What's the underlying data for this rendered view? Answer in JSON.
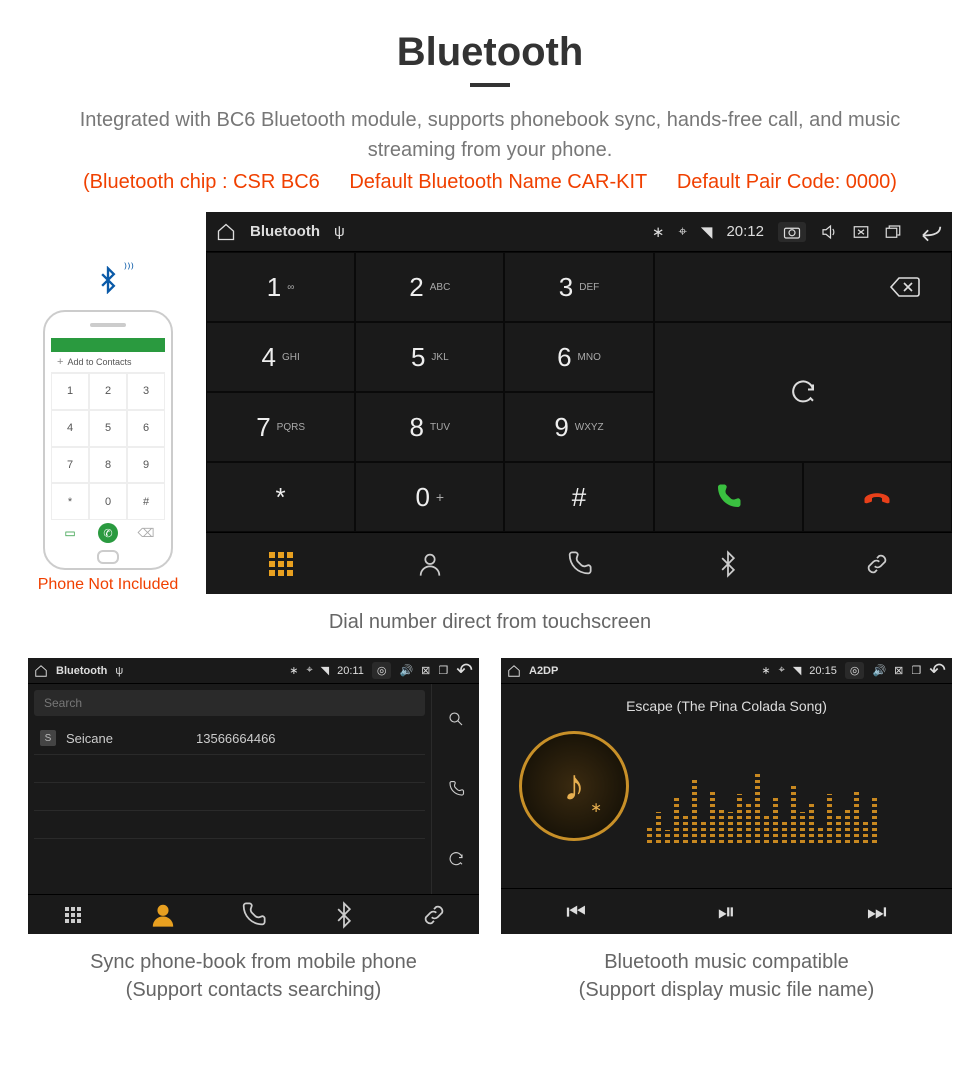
{
  "header": {
    "title": "Bluetooth",
    "description": "Integrated with BC6 Bluetooth module, supports phonebook sync, hands-free call, and music streaming from your phone.",
    "tech": {
      "chip": "(Bluetooth chip : CSR BC6",
      "name": "Default Bluetooth Name CAR-KIT",
      "code": "Default Pair Code: 0000)"
    }
  },
  "phone": {
    "add_contact": "Add to Contacts",
    "note": "Phone Not Included",
    "keys": [
      "1",
      "2",
      "3",
      "4",
      "5",
      "6",
      "7",
      "8",
      "9",
      "*",
      "0",
      "#"
    ]
  },
  "dialer": {
    "status": {
      "title": "Bluetooth",
      "time": "20:12"
    },
    "keys": [
      {
        "n": "1",
        "l": "∞"
      },
      {
        "n": "2",
        "l": "ABC"
      },
      {
        "n": "3",
        "l": "DEF"
      },
      {
        "n": "4",
        "l": "GHI"
      },
      {
        "n": "5",
        "l": "JKL"
      },
      {
        "n": "6",
        "l": "MNO"
      },
      {
        "n": "7",
        "l": "PQRS"
      },
      {
        "n": "8",
        "l": "TUV"
      },
      {
        "n": "9",
        "l": "WXYZ"
      },
      {
        "n": "*",
        "l": ""
      },
      {
        "n": "0",
        "l": "+"
      },
      {
        "n": "#",
        "l": ""
      }
    ],
    "caption": "Dial number direct from touchscreen"
  },
  "contacts": {
    "status": {
      "title": "Bluetooth",
      "time": "20:11"
    },
    "search_placeholder": "Search",
    "rows": [
      {
        "badge": "S",
        "name": "Seicane",
        "number": "13566664466"
      }
    ],
    "caption_l1": "Sync phone-book from mobile phone",
    "caption_l2": "(Support contacts searching)"
  },
  "music": {
    "status": {
      "title": "A2DP",
      "time": "20:15"
    },
    "track": "Escape (The Pina Colada Song)",
    "caption_l1": "Bluetooth music compatible",
    "caption_l2": "(Support display music file name)"
  }
}
